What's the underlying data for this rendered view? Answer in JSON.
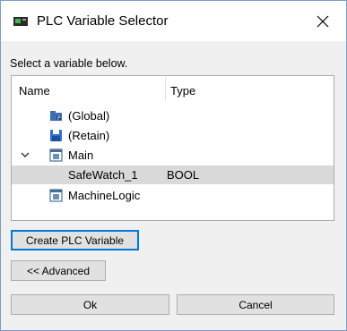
{
  "window": {
    "title": "PLC Variable Selector",
    "close_glyph": "✕"
  },
  "instruction": "Select a variable below.",
  "tree": {
    "columns": {
      "name": "Name",
      "type": "Type"
    },
    "rows": [
      {
        "label": "(Global)",
        "type": "",
        "icon": "global-variables-icon"
      },
      {
        "label": "(Retain)",
        "type": "",
        "icon": "retain-save-icon"
      },
      {
        "label": "Main",
        "type": "",
        "icon": "program-icon",
        "expanded": true
      },
      {
        "label": "SafeWatch_1",
        "type": "BOOL",
        "selected": true
      },
      {
        "label": "MachineLogic",
        "type": "",
        "icon": "program-icon"
      }
    ]
  },
  "buttons": {
    "create": "Create PLC Variable",
    "advanced": "<< Advanced",
    "ok": "Ok",
    "cancel": "Cancel"
  },
  "colors": {
    "focus_border": "#0078d7",
    "selection": "#d9d9d9",
    "dialog_bg": "#f0f0f0"
  }
}
